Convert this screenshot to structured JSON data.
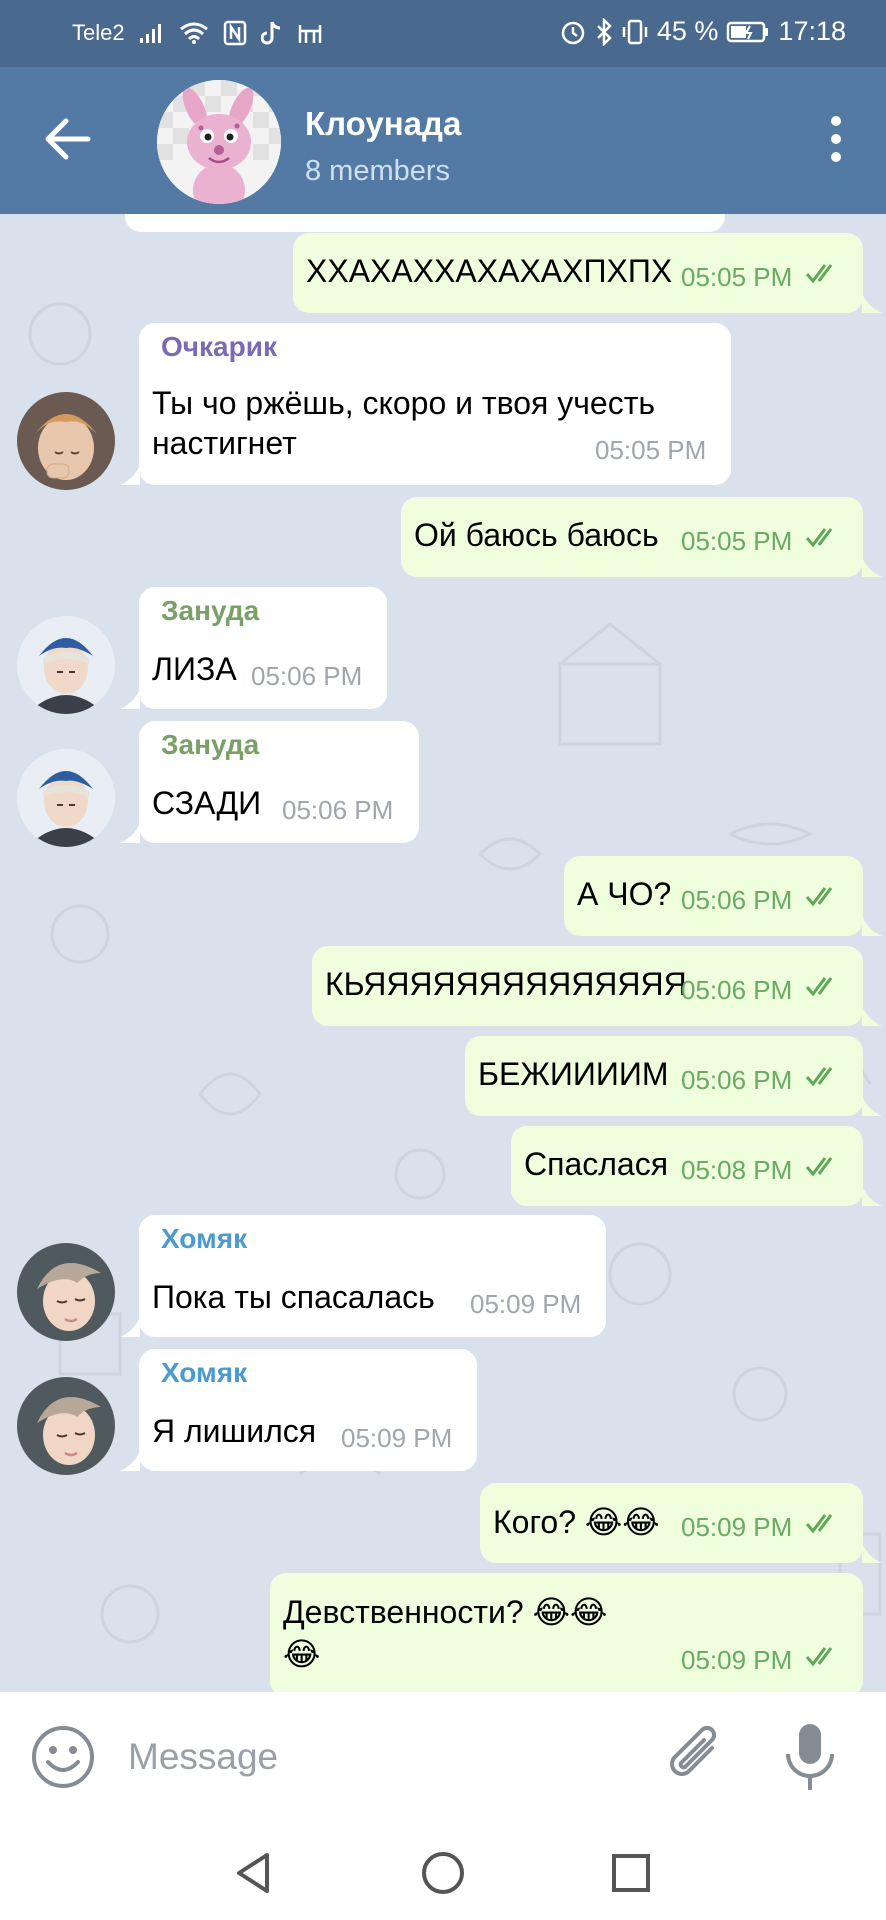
{
  "status_bar": {
    "carrier": "Tele2",
    "battery": "45 %",
    "time": "17:18"
  },
  "header": {
    "title": "Клоунада",
    "subtitle": "8 members"
  },
  "messages": [
    {
      "dir": "out",
      "text": "ХХАХАХХАХАХАХПХПХ",
      "time": "05:05 PM"
    },
    {
      "dir": "in",
      "sender": "Очкарик",
      "text_line1": "Ты чо ржёшь, скоро и твоя учесть",
      "text_line2": "настигнет",
      "time": "05:05 PM"
    },
    {
      "dir": "out",
      "text": "Ой баюсь баюсь",
      "time": "05:05 PM"
    },
    {
      "dir": "in",
      "sender": "Зануда",
      "text": "ЛИЗА",
      "time": "05:06 PM"
    },
    {
      "dir": "in",
      "sender": "Зануда",
      "text": "СЗАДИ",
      "time": "05:06 PM"
    },
    {
      "dir": "out",
      "text": "А ЧО?",
      "time": "05:06 PM"
    },
    {
      "dir": "out",
      "text": "КЬЯЯЯЯЯЯЯЯЯЯЯЯЯЯ",
      "time": "05:06 PM"
    },
    {
      "dir": "out",
      "text": "БЕЖИИИИМ",
      "time": "05:06 PM"
    },
    {
      "dir": "out",
      "text": "Спаслася",
      "time": "05:08 PM"
    },
    {
      "dir": "in",
      "sender": "Хомяк",
      "text": "Пока ты спасалась",
      "time": "05:09 PM"
    },
    {
      "dir": "in",
      "sender": "Хомяк",
      "text": "Я лишился",
      "time": "05:09 PM"
    },
    {
      "dir": "out",
      "text": "Кого? 😂😂",
      "time": "05:09 PM"
    },
    {
      "dir": "out",
      "text_line1": "Девственности? 😂😂",
      "text_line2": "😂",
      "time": "05:09 PM"
    }
  ],
  "input": {
    "placeholder": "Message"
  },
  "colors": {
    "header": "#527aa5",
    "status_bar": "#49698e",
    "out_bubble": "#effedd",
    "in_bubble": "#ffffff",
    "check": "#5ea858",
    "sender_ochkarik": "#7b6ab5",
    "sender_zanuda": "#7aa068",
    "sender_homyak": "#4b9ad0"
  },
  "icons": {
    "back": "arrow-left-icon",
    "menu": "more-vertical-icon",
    "emoji": "smile-icon",
    "attach": "paperclip-icon",
    "mic": "microphone-icon",
    "read": "double-check-icon"
  }
}
